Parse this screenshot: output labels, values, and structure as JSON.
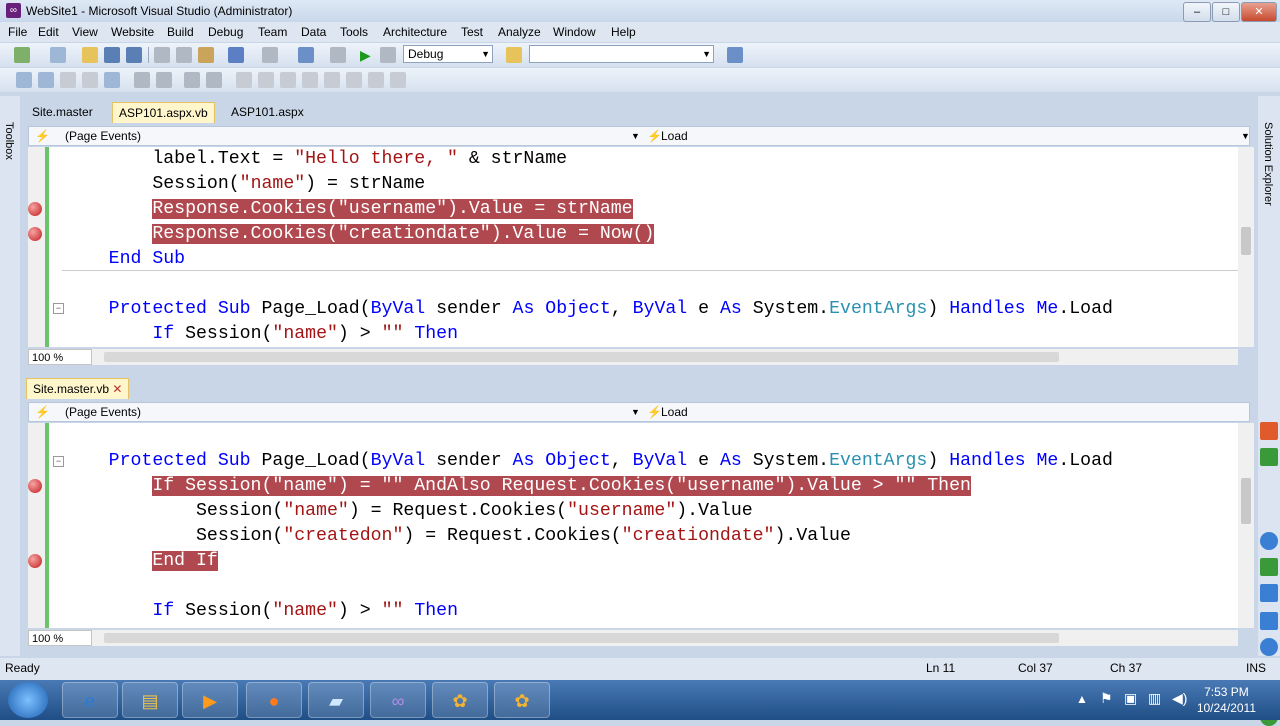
{
  "window": {
    "title": "WebSite1 - Microsoft Visual Studio (Administrator)",
    "minimize": "–",
    "maximize": "□",
    "close": "✕"
  },
  "menu": [
    "File",
    "Edit",
    "View",
    "Website",
    "Build",
    "Debug",
    "Team",
    "Data",
    "Tools",
    "Architecture",
    "Test",
    "Analyze",
    "Window",
    "Help"
  ],
  "toolbar": {
    "config_value": "Debug",
    "find_value": ""
  },
  "side": {
    "left": "Toolbox",
    "right": "Solution Explorer"
  },
  "top_pane": {
    "tabs": [
      "Site.master",
      "ASP101.aspx.vb",
      "ASP101.aspx"
    ],
    "nav_left": "(Page Events)",
    "nav_right": "Load",
    "zoom": "100 %",
    "lines": [
      {
        "indent": "        ",
        "parts": [
          [
            "label.Text = ",
            ""
          ],
          [
            "\"Hello there, \"",
            "str"
          ],
          [
            " & strName",
            ""
          ]
        ],
        "hl": false,
        "bp": false
      },
      {
        "indent": "        ",
        "parts": [
          [
            "Session(",
            ""
          ],
          [
            "\"name\"",
            "str"
          ],
          [
            ") = strName",
            ""
          ]
        ],
        "hl": false,
        "bp": false
      },
      {
        "indent": "        ",
        "parts": [
          [
            "Response.Cookies(",
            ""
          ],
          [
            "\"username\"",
            "str"
          ],
          [
            ").Value = strName",
            ""
          ]
        ],
        "hl": true,
        "bp": true
      },
      {
        "indent": "        ",
        "parts": [
          [
            "Response.Cookies(",
            ""
          ],
          [
            "\"creationdate\"",
            "str"
          ],
          [
            ").Value = Now()",
            ""
          ]
        ],
        "hl": true,
        "bp": true
      },
      {
        "indent": "    ",
        "parts": [
          [
            "End Sub",
            "kw"
          ]
        ],
        "hl": false,
        "bp": false
      },
      {
        "indent": "",
        "parts": [],
        "hl": false,
        "bp": false
      },
      {
        "indent": "    ",
        "parts": [
          [
            "Protected Sub",
            "kw"
          ],
          [
            " Page_Load(",
            ""
          ],
          [
            "ByVal",
            "kw"
          ],
          [
            " sender ",
            ""
          ],
          [
            "As Object",
            "kw"
          ],
          [
            ", ",
            ""
          ],
          [
            "ByVal",
            "kw"
          ],
          [
            " e ",
            ""
          ],
          [
            "As",
            "kw"
          ],
          [
            " System.",
            ""
          ],
          [
            "EventArgs",
            "typ"
          ],
          [
            ") ",
            ""
          ],
          [
            "Handles Me",
            "kw"
          ],
          [
            ".Load",
            ""
          ]
        ],
        "hl": false,
        "bp": false
      },
      {
        "indent": "        ",
        "parts": [
          [
            "If",
            "kw"
          ],
          [
            " Session(",
            ""
          ],
          [
            "\"name\"",
            "str"
          ],
          [
            ") > ",
            ""
          ],
          [
            "\"\"",
            "str"
          ],
          [
            " ",
            ""
          ],
          [
            "Then",
            "kw"
          ]
        ],
        "hl": false,
        "bp": false
      }
    ]
  },
  "bottom_pane": {
    "tabs": [
      "Site.master.vb"
    ],
    "nav_left": "(Page Events)",
    "nav_right": "Load",
    "zoom": "100 %",
    "lines": [
      {
        "indent": "",
        "parts": [],
        "hl": false,
        "bp": false
      },
      {
        "indent": "    ",
        "parts": [
          [
            "Protected Sub",
            "kw"
          ],
          [
            " Page_Load(",
            ""
          ],
          [
            "ByVal",
            "kw"
          ],
          [
            " sender ",
            ""
          ],
          [
            "As Object",
            "kw"
          ],
          [
            ", ",
            ""
          ],
          [
            "ByVal",
            "kw"
          ],
          [
            " e ",
            ""
          ],
          [
            "As",
            "kw"
          ],
          [
            " System.",
            ""
          ],
          [
            "EventArgs",
            "typ"
          ],
          [
            ") ",
            ""
          ],
          [
            "Handles Me",
            "kw"
          ],
          [
            ".Load",
            ""
          ]
        ],
        "hl": false,
        "bp": false
      },
      {
        "indent": "        ",
        "parts": [
          [
            "If Session(\"name\") = \"\" AndAlso Request.Cookies(\"username\").Value > \"\" Then",
            ""
          ]
        ],
        "hl": true,
        "bp": true
      },
      {
        "indent": "            ",
        "parts": [
          [
            "Session(",
            ""
          ],
          [
            "\"name\"",
            "str"
          ],
          [
            ") = Request.Cookies(",
            ""
          ],
          [
            "\"username\"",
            "str"
          ],
          [
            ").Value",
            ""
          ]
        ],
        "hl": false,
        "bp": false
      },
      {
        "indent": "            ",
        "parts": [
          [
            "Session(",
            ""
          ],
          [
            "\"createdon\"",
            "str"
          ],
          [
            ") = Request.Cookies(",
            ""
          ],
          [
            "\"creationdate\"",
            "str"
          ],
          [
            ").Value",
            ""
          ]
        ],
        "hl": false,
        "bp": false
      },
      {
        "indent": "        ",
        "parts": [
          [
            "End If",
            ""
          ]
        ],
        "hl": true,
        "bp": true
      },
      {
        "indent": "",
        "parts": [],
        "hl": false,
        "bp": false
      },
      {
        "indent": "        ",
        "parts": [
          [
            "If",
            "kw"
          ],
          [
            " Session(",
            ""
          ],
          [
            "\"name\"",
            "str"
          ],
          [
            ") > ",
            ""
          ],
          [
            "\"\"",
            "str"
          ],
          [
            " ",
            ""
          ],
          [
            "Then",
            "kw"
          ]
        ],
        "hl": false,
        "bp": false
      }
    ]
  },
  "status": {
    "ready": "Ready",
    "ln": "Ln 11",
    "col": "Col 37",
    "ch": "Ch 37",
    "mode": "INS"
  },
  "clock": {
    "time": "7:53 PM",
    "date": "10/24/2011"
  }
}
